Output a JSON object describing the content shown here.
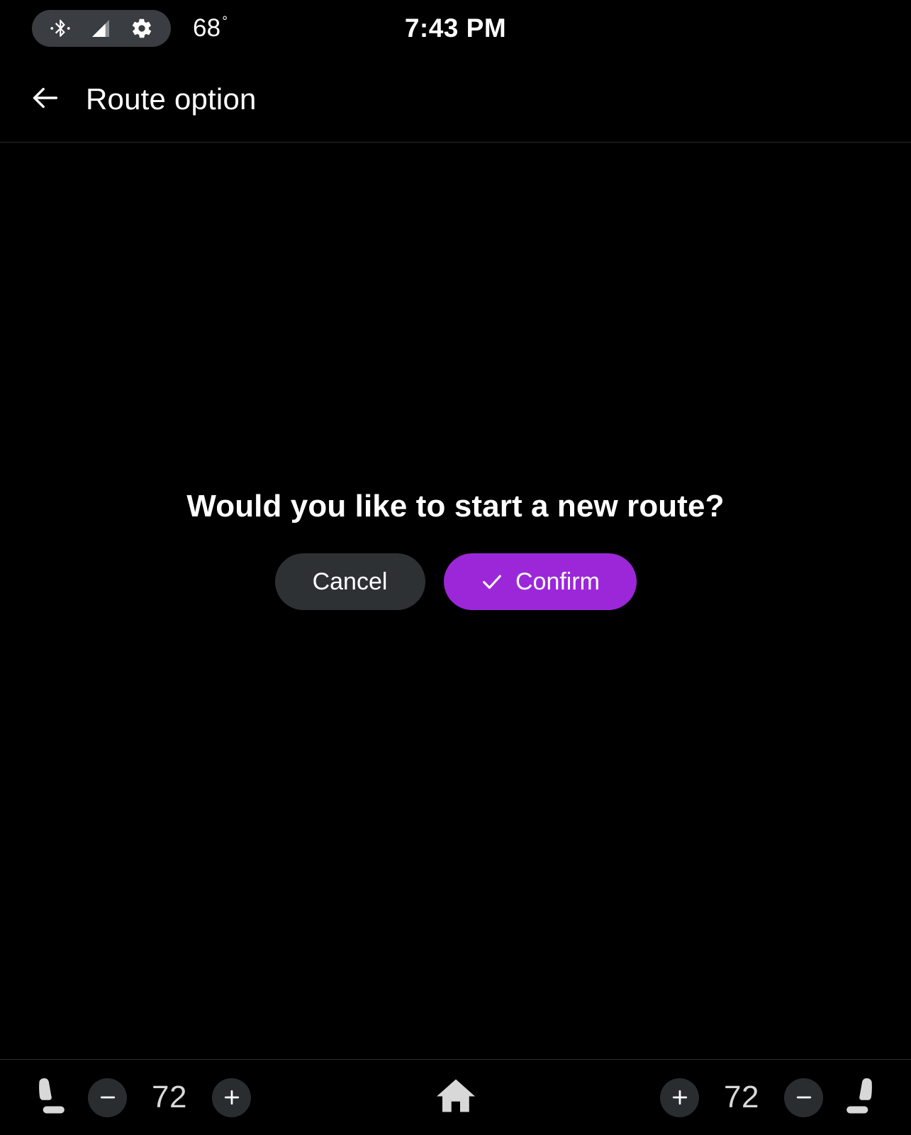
{
  "status_bar": {
    "icons": [
      {
        "name": "bluetooth-icon",
        "label": "Bluetooth"
      },
      {
        "name": "signal-icon",
        "label": "Cellular signal"
      },
      {
        "name": "gear-icon",
        "label": "Settings"
      }
    ],
    "temperature": "68",
    "degree_symbol": "°",
    "clock": "7:43 PM",
    "pill_color": "#3a3d41"
  },
  "app_bar": {
    "back_icon": "arrow-left-icon",
    "title": "Route option"
  },
  "dialog": {
    "title": "Would you like to start a new route?",
    "cancel_label": "Cancel",
    "confirm_label": "Confirm",
    "confirm_icon": "check-icon",
    "cancel_color": "#2e3134",
    "confirm_color": "#9c27d9"
  },
  "bottom_bar": {
    "left_climate": {
      "seat_icon": "seat-icon",
      "decrease_label": "−",
      "temperature": "72",
      "increase_label": "+"
    },
    "home_icon": "home-icon",
    "right_climate": {
      "increase_label": "+",
      "temperature": "72",
      "decrease_label": "−",
      "seat_icon": "seat-icon"
    },
    "step_button_color": "#2a2d30",
    "value_color": "#d8d8d8"
  }
}
